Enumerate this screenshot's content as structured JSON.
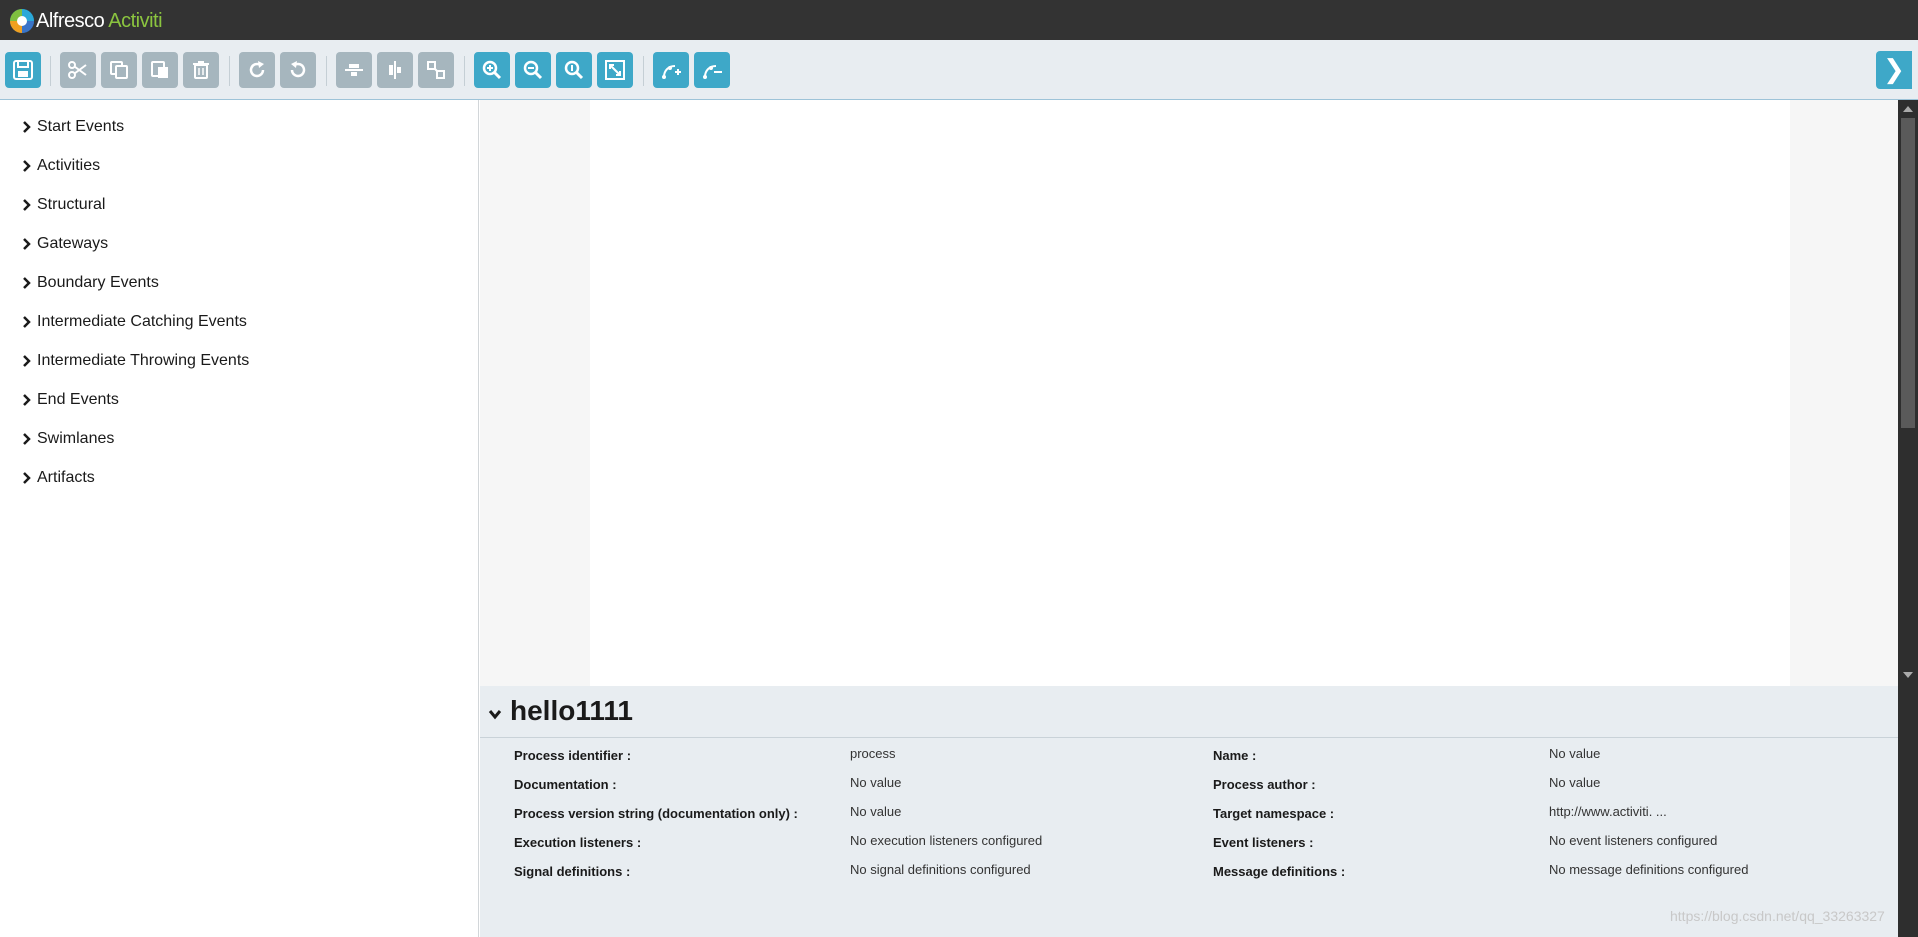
{
  "header": {
    "logo_primary": "Alfresco",
    "logo_secondary": "Activiti"
  },
  "toolbar": {
    "buttons": [
      {
        "icon": "save-icon",
        "tooltip": "Save the model"
      },
      {
        "icon": "cut-icon",
        "tooltip": "Cut"
      },
      {
        "icon": "copy-icon",
        "tooltip": "Copy"
      },
      {
        "icon": "paste-icon",
        "tooltip": "Paste"
      },
      {
        "icon": "delete-icon",
        "tooltip": "Delete"
      },
      {
        "icon": "redo-icon",
        "tooltip": "Redo"
      },
      {
        "icon": "undo-icon",
        "tooltip": "Undo"
      },
      {
        "icon": "align-vertical-icon",
        "tooltip": "Align vertical"
      },
      {
        "icon": "align-horizontal-icon",
        "tooltip": "Align horizontal"
      },
      {
        "icon": "same-size-icon",
        "tooltip": "Same size"
      },
      {
        "icon": "zoom-in-icon",
        "tooltip": "Zoom in"
      },
      {
        "icon": "zoom-out-icon",
        "tooltip": "Zoom out"
      },
      {
        "icon": "zoom-actual-icon",
        "tooltip": "Zoom to actual size"
      },
      {
        "icon": "zoom-fit-icon",
        "tooltip": "Zoom to fit"
      },
      {
        "icon": "add-bendpoint-icon",
        "tooltip": "Add bendpoint"
      },
      {
        "icon": "remove-bendpoint-icon",
        "tooltip": "Remove bendpoint"
      }
    ],
    "collapse_label": "❯",
    "colors": {
      "active": "#3ea8c8",
      "disabled": "#a6b6be"
    }
  },
  "palette": {
    "groups": [
      {
        "label": "Start Events"
      },
      {
        "label": "Activities"
      },
      {
        "label": "Structural"
      },
      {
        "label": "Gateways"
      },
      {
        "label": "Boundary Events"
      },
      {
        "label": "Intermediate Catching Events"
      },
      {
        "label": "Intermediate Throwing Events"
      },
      {
        "label": "End Events"
      },
      {
        "label": "Swimlanes"
      },
      {
        "label": "Artifacts"
      }
    ]
  },
  "properties": {
    "title": "hello1111",
    "left": [
      {
        "label": "Process identifier :",
        "value": "process"
      },
      {
        "label": "Documentation :",
        "value": "No value"
      },
      {
        "label": "Process version string (documentation only) :",
        "value": "No value"
      },
      {
        "label": "Execution listeners :",
        "value": "No execution listeners configured"
      },
      {
        "label": "Signal definitions :",
        "value": "No signal definitions configured"
      }
    ],
    "right": [
      {
        "label": "Name :",
        "value": "No value"
      },
      {
        "label": "Process author :",
        "value": "No value"
      },
      {
        "label": "Target namespace :",
        "value": "http://www.activiti. ..."
      },
      {
        "label": "Event listeners :",
        "value": "No event listeners configured"
      },
      {
        "label": "Message definitions :",
        "value": "No message definitions configured"
      }
    ]
  },
  "watermark": "https://blog.csdn.net/qq_33263327"
}
